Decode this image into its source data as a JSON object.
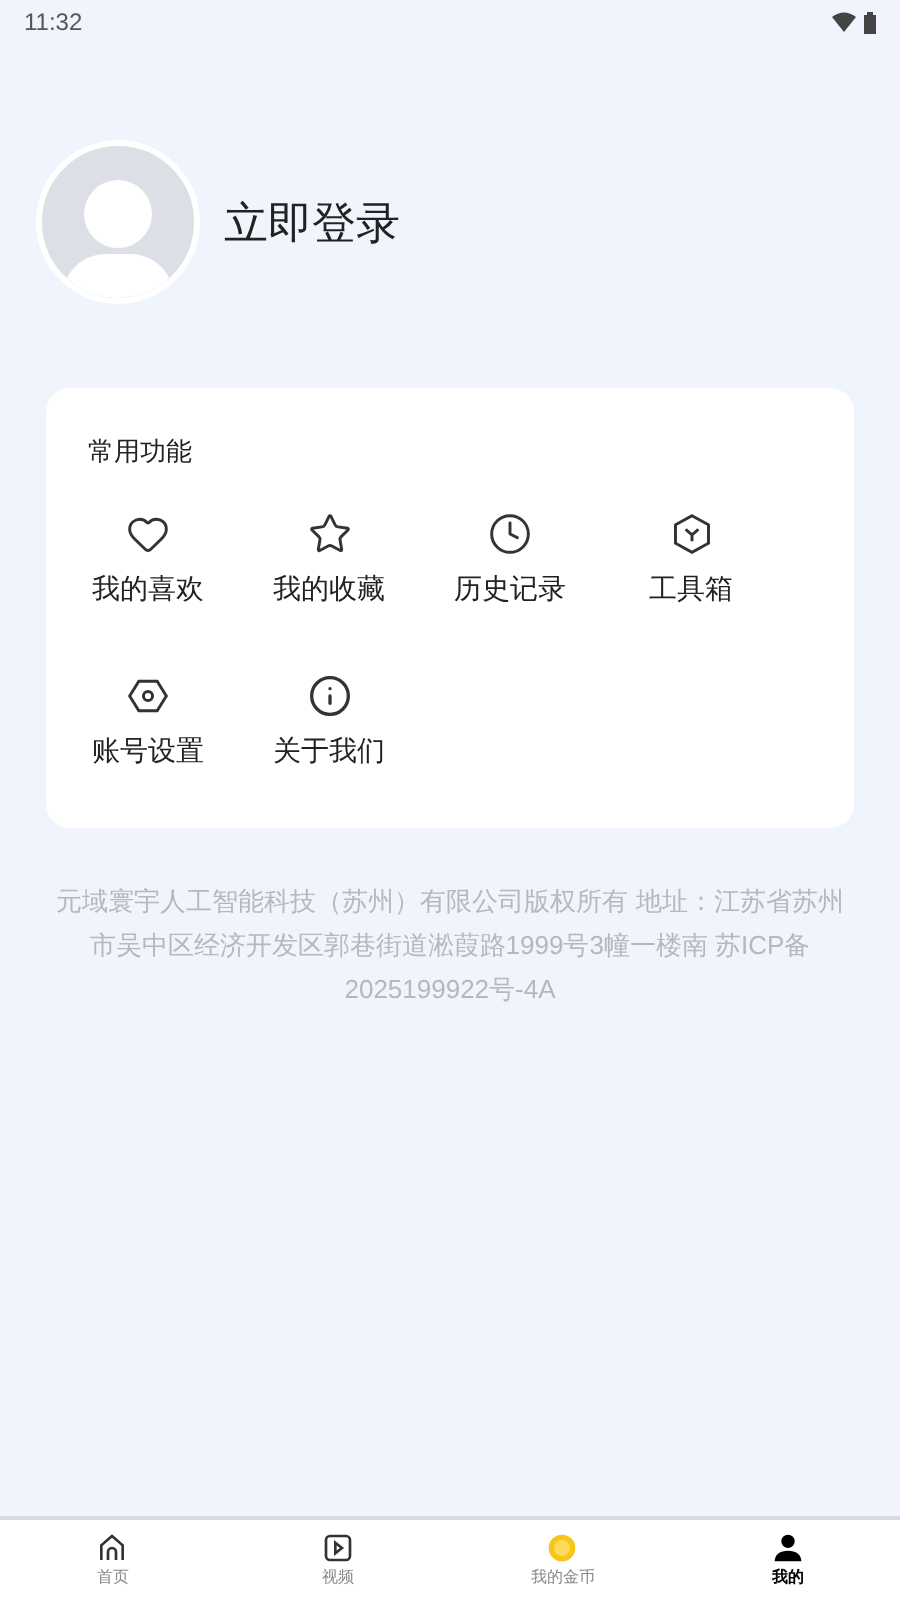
{
  "status_bar": {
    "time": "11:32"
  },
  "profile": {
    "login_label": "立即登录"
  },
  "functions": {
    "title": "常用功能",
    "items": [
      {
        "kind": "heart",
        "label": "我的喜欢"
      },
      {
        "kind": "star",
        "label": "我的收藏"
      },
      {
        "kind": "clock",
        "label": "历史记录"
      },
      {
        "kind": "toolbox",
        "label": "工具箱"
      },
      {
        "kind": "settings",
        "label": "账号设置"
      },
      {
        "kind": "info",
        "label": "关于我们"
      }
    ]
  },
  "footer": "元域寰宇人工智能科技（苏州）有限公司版权所有 地址：江苏省苏州市吴中区经济开发区郭巷街道淞葭路1999号3幢一楼南 苏ICP备2025199922号-4A",
  "tab_bar": [
    {
      "kind": "home",
      "label": "首页",
      "selected": false
    },
    {
      "kind": "video",
      "label": "视频",
      "selected": false
    },
    {
      "kind": "coin",
      "label": "我的金币",
      "selected": false
    },
    {
      "kind": "user",
      "label": "我的",
      "selected": true
    }
  ]
}
